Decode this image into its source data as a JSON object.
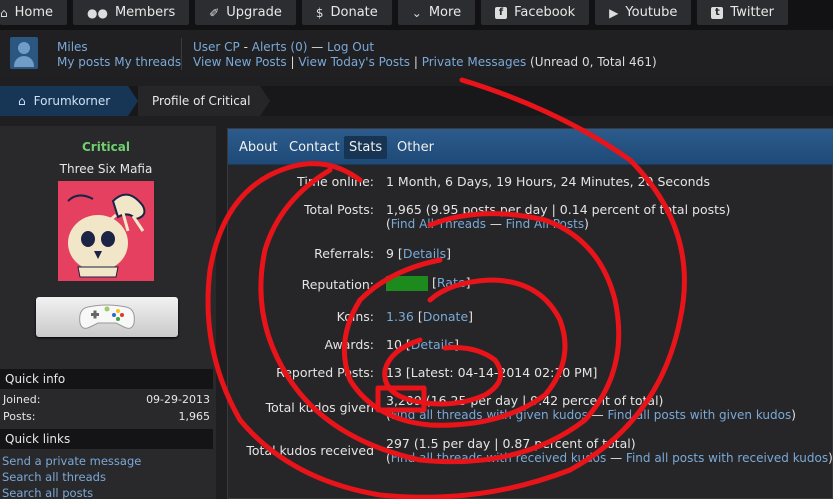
{
  "nav": {
    "items": [
      {
        "label": "Home",
        "icon": "home-icon",
        "glyph": "⌂"
      },
      {
        "label": "Members",
        "icon": "members-icon",
        "glyph": "👥"
      },
      {
        "label": "Upgrade",
        "icon": "upgrade-icon",
        "glyph": "✐"
      },
      {
        "label": "Donate",
        "icon": "dollar-icon",
        "glyph": "$"
      },
      {
        "label": "More",
        "icon": "chevron-down-icon",
        "glyph": "⌄"
      },
      {
        "label": "Facebook",
        "icon": "facebook-icon",
        "glyph": "f"
      },
      {
        "label": "Youtube",
        "icon": "play-icon",
        "glyph": "▶"
      },
      {
        "label": "Twitter",
        "icon": "twitter-icon",
        "glyph": "t"
      }
    ]
  },
  "userbar": {
    "username": "Miles",
    "my_posts": "My posts",
    "my_threads": "My threads",
    "user_cp": "User CP",
    "dash1": " - ",
    "alerts": "Alerts (0)",
    "dash2": " — ",
    "logout": "Log Out",
    "view_new": "View New Posts",
    "pipe": " | ",
    "view_today": "View Today's Posts",
    "private_messages": "Private Messages",
    "pm_counts": " (Unread 0, Total 461)"
  },
  "breadcrumb": {
    "home_label": "Forumkorner",
    "current": "Profile of Critical"
  },
  "sidebar": {
    "name": "Critical",
    "usertitle": "Three Six Mafia",
    "quick_info_heading": "Quick info",
    "joined_label": "Joined:",
    "joined_value": "09-29-2013",
    "posts_label": "Posts:",
    "posts_value": "1,965",
    "quick_links_heading": "Quick links",
    "links": [
      "Send a private message",
      "Search all threads",
      "Search all posts"
    ]
  },
  "tabs": [
    "About",
    "Contact",
    "Stats",
    "Other"
  ],
  "active_tab": "Stats",
  "stats": {
    "time_online": {
      "label": "Time online:",
      "value": "1 Month, 6 Days, 19 Hours, 24 Minutes, 20 Seconds"
    },
    "total_posts": {
      "label": "Total Posts:",
      "value": "1,965 (9.95 posts per day | 0.14 percent of total posts)",
      "find_threads": "Find All Threads",
      "dash": " — ",
      "find_posts": "Find All Posts"
    },
    "referrals": {
      "label": "Referrals:",
      "value": "9",
      "details": "Details"
    },
    "reputation": {
      "label": "Reputation:",
      "rate": "Rate",
      "rep_color": "#1c8a1c"
    },
    "koins": {
      "label": "Koins:",
      "value": "1.36",
      "donate": "Donate"
    },
    "awards": {
      "label": "Awards:",
      "value": "10",
      "details": "Details"
    },
    "reported_posts": {
      "label": "Reported Posts:",
      "value": "13 [Latest: 04-14-2014 02:10 PM]"
    },
    "kudos_given": {
      "label": "Total kudos given",
      "value": "3,209 (16.25 per day | 9.42 percent of total)",
      "link_threads": "Find all threads with given kudos",
      "dash": " — ",
      "link_posts": "Find all posts with given kudos"
    },
    "kudos_received": {
      "label": "Total kudos received",
      "value": "297 (1.5 per day | 0.87 percent of total)",
      "link_threads": "Find all threads with received kudos",
      "dash": " — ",
      "link_posts": "Find all posts with received kudos"
    }
  },
  "colors": {
    "accent": "#2c5b8c",
    "link": "#7aa9d8",
    "username_green": "#6fd06f",
    "annotation_red": "#e8141a"
  }
}
